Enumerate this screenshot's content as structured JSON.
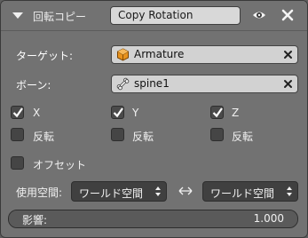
{
  "header": {
    "type_label": "回転コピー",
    "name": "Copy Rotation",
    "icons": [
      "chevron-down-icon",
      "eye-icon",
      "close-icon"
    ]
  },
  "target": {
    "label": "ターゲット:",
    "value": "Armature",
    "icon": "armature-object-icon"
  },
  "bone": {
    "label": "ボーン:",
    "value": "spine1",
    "icon": "bone-icon"
  },
  "axes": [
    {
      "label": "X",
      "checked": true,
      "invert_label": "反転",
      "invert_checked": false
    },
    {
      "label": "Y",
      "checked": true,
      "invert_label": "反転",
      "invert_checked": false
    },
    {
      "label": "Z",
      "checked": true,
      "invert_label": "反転",
      "invert_checked": false
    }
  ],
  "offset": {
    "label": "オフセット",
    "checked": false
  },
  "space": {
    "label": "使用空間:",
    "owner": "ワールド空間",
    "target": "ワールド空間"
  },
  "influence": {
    "label": "影響:",
    "value": "1.000",
    "fraction": 1.0
  },
  "colors": {
    "panel": "#727272",
    "field": "#d2d2d2",
    "checkbox": "#454545",
    "dropdown": "#404040"
  }
}
